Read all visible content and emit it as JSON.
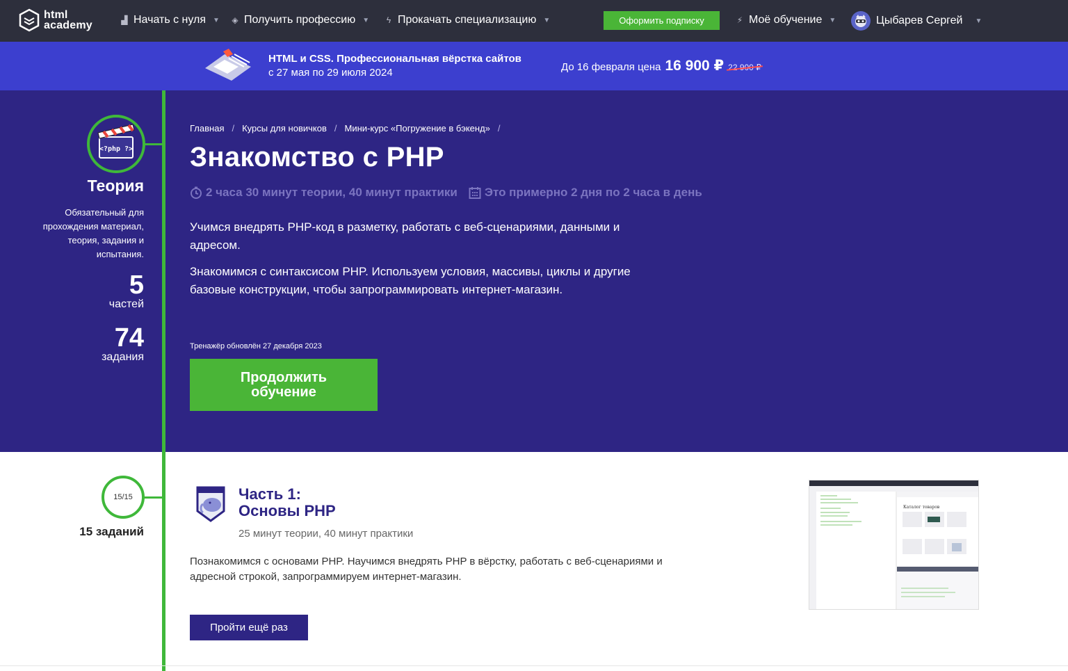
{
  "nav": {
    "logo_line1": "html",
    "logo_line2": "academy",
    "items": [
      {
        "label": "Начать с нуля"
      },
      {
        "label": "Получить профессию"
      },
      {
        "label": "Прокачать специализацию"
      }
    ],
    "subscribe_label": "Оформить подписку",
    "my_learning_label": "Моё обучение",
    "user_name": "Цыбарев Сергей"
  },
  "promo": {
    "title": "HTML и CSS. Профессиональная вёрстка сайтов",
    "dates": "с 27 мая по 29 июля 2024",
    "price_prefix": "До 16 февраля цена",
    "price": "16 900 ₽",
    "old_price": "22 900 ₽"
  },
  "theory": {
    "title": "Теория",
    "description": "Обязательный для прохождения материал, теория, задания и испытания.",
    "parts_count": "5",
    "parts_label": "частей",
    "tasks_count": "74",
    "tasks_label": "задания",
    "badge_text": "<?php ?>"
  },
  "breadcrumb": [
    "Главная",
    "Курсы для новичков",
    "Мини-курс «Погружение в бэкенд»"
  ],
  "hero": {
    "title": "Знакомство с PHP",
    "duration": "2 часа 30 минут теории, 40 минут практики",
    "schedule": "Это примерно 2 дня по 2 часа в день",
    "p1": "Учимся внедрять PHP-код в разметку, работать с веб-сценариями, данными и адресом.",
    "p2": "Знакомимся с синтаксисом PHP. Используем условия, массивы, циклы и другие базовые конструкции, чтобы запрограммировать интернет-магазин.",
    "updated": "Тренажёр обновлён 27 декабря 2023",
    "continue_label": "Продолжить обучение"
  },
  "part1": {
    "progress": "15/15",
    "tasks": "15 заданий",
    "title_line1": "Часть 1:",
    "title_line2": "Основы PHP",
    "meta": "25 минут теории, 40 минут практики",
    "description": "Познакомимся с основами PHP. Научимся внедрять PHP в вёрстку, работать с веб-сценариями и адресной строкой, запрограммируем интернет-магазин.",
    "retry_label": "Пройти ещё раз",
    "preview_heading": "Каталог товаров"
  },
  "colors": {
    "nav_bg": "#2d2f3c",
    "promo_bg": "#3c3fcf",
    "hero_bg": "#2e2584",
    "accent_green": "#4ab537"
  }
}
